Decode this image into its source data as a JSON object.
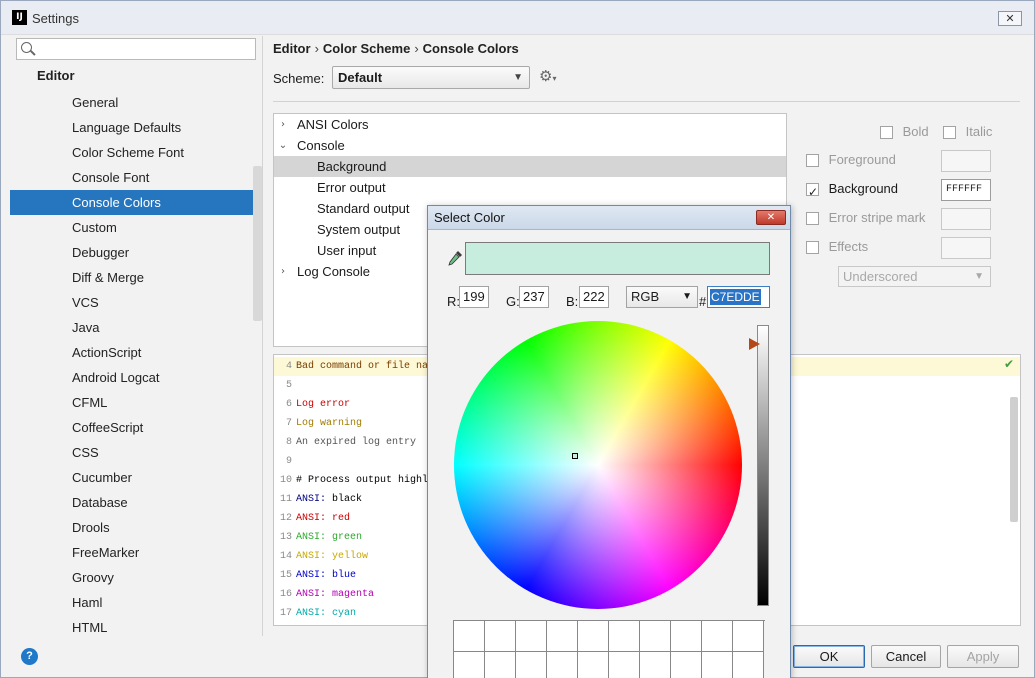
{
  "window": {
    "title": "Settings",
    "icon_text": "IJ",
    "close_glyph": "✕"
  },
  "search": {
    "value": "",
    "placeholder": ""
  },
  "sidebar": {
    "header": "Editor",
    "items": [
      {
        "label": "General",
        "selected": false
      },
      {
        "label": "Language Defaults",
        "selected": false
      },
      {
        "label": "Color Scheme Font",
        "selected": false
      },
      {
        "label": "Console Font",
        "selected": false
      },
      {
        "label": "Console Colors",
        "selected": true
      },
      {
        "label": "Custom",
        "selected": false
      },
      {
        "label": "Debugger",
        "selected": false
      },
      {
        "label": "Diff & Merge",
        "selected": false
      },
      {
        "label": "VCS",
        "selected": false
      },
      {
        "label": "Java",
        "selected": false
      },
      {
        "label": "ActionScript",
        "selected": false
      },
      {
        "label": "Android Logcat",
        "selected": false
      },
      {
        "label": "CFML",
        "selected": false
      },
      {
        "label": "CoffeeScript",
        "selected": false
      },
      {
        "label": "CSS",
        "selected": false
      },
      {
        "label": "Cucumber",
        "selected": false
      },
      {
        "label": "Database",
        "selected": false
      },
      {
        "label": "Drools",
        "selected": false
      },
      {
        "label": "FreeMarker",
        "selected": false
      },
      {
        "label": "Groovy",
        "selected": false
      },
      {
        "label": "Haml",
        "selected": false
      },
      {
        "label": "HTML",
        "selected": false
      }
    ]
  },
  "breadcrumb": [
    "Editor",
    "Color Scheme",
    "Console Colors"
  ],
  "breadcrumb_sep": "›",
  "scheme": {
    "label": "Scheme:",
    "value": "Default"
  },
  "tree": [
    {
      "label": "ANSI Colors",
      "level": 0,
      "arrow": "›",
      "selected": false
    },
    {
      "label": "Console",
      "level": 0,
      "arrow": "⌄",
      "selected": false
    },
    {
      "label": "Background",
      "level": 1,
      "arrow": "",
      "selected": true
    },
    {
      "label": "Error output",
      "level": 1,
      "arrow": "",
      "selected": false
    },
    {
      "label": "Standard output",
      "level": 1,
      "arrow": "",
      "selected": false
    },
    {
      "label": "System output",
      "level": 1,
      "arrow": "",
      "selected": false
    },
    {
      "label": "User input",
      "level": 1,
      "arrow": "",
      "selected": false
    },
    {
      "label": "Log Console",
      "level": 0,
      "arrow": "›",
      "selected": false
    }
  ],
  "options": {
    "bold": "Bold",
    "italic": "Italic",
    "foreground": "Foreground",
    "background": "Background",
    "background_value": "FFFFFF",
    "error_stripe": "Error stripe mark",
    "effects": "Effects",
    "effect_type": "Underscored"
  },
  "preview": {
    "lines": [
      {
        "n": "4",
        "text": "Bad command or file na",
        "color": "#7a3d00",
        "hl": true
      },
      {
        "n": "5",
        "text": "",
        "color": "#000000",
        "hl": false
      },
      {
        "n": "6",
        "text": "Log error",
        "color": "#cc0000",
        "hl": false
      },
      {
        "n": "7",
        "text": "Log warning",
        "color": "#a37c00",
        "hl": false
      },
      {
        "n": "8",
        "text": "An expired log entry",
        "color": "#555555",
        "hl": false
      },
      {
        "n": "9",
        "text": "",
        "color": "#000000",
        "hl": false
      },
      {
        "n": "10",
        "text": "# Process output highl",
        "color": "#000000",
        "hl": false
      },
      {
        "n": "11",
        "text": "ANSI: black",
        "color": "#000000",
        "hl": false,
        "prefix": "ANSI:",
        "prefix_color": "#000080"
      },
      {
        "n": "12",
        "text": "ANSI: red",
        "color": "#cc0000",
        "hl": false,
        "prefix": "ANSI:",
        "prefix_color": "#cc0000"
      },
      {
        "n": "13",
        "text": "ANSI: green",
        "color": "#2ea82e",
        "hl": false,
        "prefix": "ANSI:",
        "prefix_color": "#2ea82e"
      },
      {
        "n": "14",
        "text": "ANSI: yellow",
        "color": "#c8a800",
        "hl": false,
        "prefix": "ANSI:",
        "prefix_color": "#c8a800"
      },
      {
        "n": "15",
        "text": "ANSI: blue",
        "color": "#0000cc",
        "hl": false,
        "prefix": "ANSI:",
        "prefix_color": "#0000cc"
      },
      {
        "n": "16",
        "text": "ANSI: magenta",
        "color": "#b400b4",
        "hl": false,
        "prefix": "ANSI:",
        "prefix_color": "#b400b4"
      },
      {
        "n": "17",
        "text": "ANSI: cyan",
        "color": "#00aaaa",
        "hl": false,
        "prefix": "ANSI:",
        "prefix_color": "#00aaaa"
      }
    ]
  },
  "buttons": {
    "ok": "OK",
    "cancel": "Cancel",
    "apply": "Apply",
    "help": "?"
  },
  "color_dialog": {
    "title": "Select Color",
    "close_glyph": "✕",
    "r_label": "R:",
    "r": "199",
    "g_label": "G:",
    "g": "237",
    "b_label": "B:",
    "b": "222",
    "mode": "RGB",
    "hex_label": "#",
    "hex": "C7EDDE",
    "swatch_color": "#c7edde"
  },
  "colors": {
    "accent": "#2675bf",
    "selection_gray": "#d5d5d5",
    "highlight_line": "#fdf8d5"
  }
}
